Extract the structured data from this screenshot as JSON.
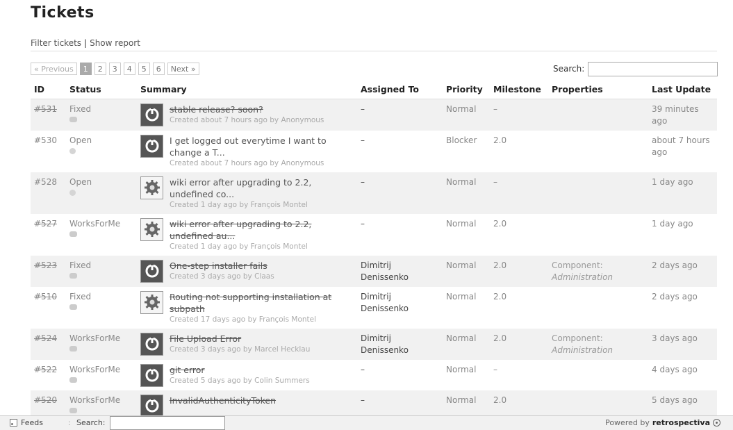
{
  "page_title": "Tickets",
  "subnav": {
    "filter": "Filter tickets",
    "separator": "|",
    "report": "Show report"
  },
  "pager": {
    "previous": "« Previous",
    "pages": [
      "1",
      "2",
      "3",
      "4",
      "5",
      "6"
    ],
    "current": "1",
    "next": "Next »"
  },
  "search": {
    "label": "Search:",
    "value": ""
  },
  "columns": {
    "id": "ID",
    "status": "Status",
    "summary": "Summary",
    "assigned": "Assigned To",
    "priority": "Priority",
    "milestone": "Milestone",
    "properties": "Properties",
    "updated": "Last Update"
  },
  "tickets": [
    {
      "id": "#531",
      "closed": true,
      "status": "Fixed",
      "avatar": "power-icon",
      "title": "stable release? soon?",
      "meta": "Created about 7 hours ago by Anonymous",
      "assigned": "–",
      "priority": "Normal",
      "milestone": "–",
      "prop_label": "",
      "prop_value": "",
      "updated": "39 minutes ago"
    },
    {
      "id": "#530",
      "closed": false,
      "status": "Open",
      "avatar": "power-icon",
      "title": "I get logged out everytime I want to change a T...",
      "meta": "Created about 7 hours ago by Anonymous",
      "assigned": "–",
      "priority": "Blocker",
      "milestone": "2.0",
      "prop_label": "",
      "prop_value": "",
      "updated": "about 7 hours ago"
    },
    {
      "id": "#528",
      "closed": false,
      "status": "Open",
      "avatar": "gear-icon",
      "title": "wiki error after upgrading to 2.2, undefined co...",
      "meta": "Created 1 day ago by François Montel",
      "assigned": "–",
      "priority": "Normal",
      "milestone": "–",
      "prop_label": "",
      "prop_value": "",
      "updated": "1 day ago"
    },
    {
      "id": "#527",
      "closed": true,
      "status": "WorksForMe",
      "avatar": "gear-icon",
      "title": "wiki error after upgrading to 2.2, undefined au...",
      "meta": "Created 1 day ago by François Montel",
      "assigned": "–",
      "priority": "Normal",
      "milestone": "2.0",
      "prop_label": "",
      "prop_value": "",
      "updated": "1 day ago"
    },
    {
      "id": "#523",
      "closed": true,
      "status": "Fixed",
      "avatar": "power-icon",
      "title": "One-step installer fails",
      "meta": "Created 3 days ago by Claas",
      "assigned": "Dimitrij Denissenko",
      "priority": "Normal",
      "milestone": "2.0",
      "prop_label": "Component:",
      "prop_value": "Administration",
      "updated": "2 days ago"
    },
    {
      "id": "#510",
      "closed": true,
      "status": "Fixed",
      "avatar": "gear-icon",
      "title": "Routing not supporting installation at subpath",
      "meta": "Created 17 days ago by François Montel",
      "assigned": "Dimitrij Denissenko",
      "priority": "Normal",
      "milestone": "2.0",
      "prop_label": "",
      "prop_value": "",
      "updated": "2 days ago"
    },
    {
      "id": "#524",
      "closed": true,
      "status": "WorksForMe",
      "avatar": "power-icon",
      "title": "File Upload Error",
      "meta": "Created 3 days ago by Marcel Hecklau",
      "assigned": "Dimitrij Denissenko",
      "priority": "Normal",
      "milestone": "2.0",
      "prop_label": "Component:",
      "prop_value": "Administration",
      "updated": "3 days ago"
    },
    {
      "id": "#522",
      "closed": true,
      "status": "WorksForMe",
      "avatar": "power-icon",
      "title": "git error",
      "meta": "Created 5 days ago by Colin Summers",
      "assigned": "–",
      "priority": "Normal",
      "milestone": "–",
      "prop_label": "",
      "prop_value": "",
      "updated": "4 days ago"
    },
    {
      "id": "#520",
      "closed": true,
      "status": "WorksForMe",
      "avatar": "power-icon",
      "title": "InvalidAuthenticityToken",
      "meta": "",
      "assigned": "–",
      "priority": "Normal",
      "milestone": "2.0",
      "prop_label": "",
      "prop_value": "",
      "updated": "5 days ago"
    }
  ],
  "footer": {
    "feeds": "Feeds",
    "search_label": "Search:",
    "search_value": "",
    "powered_by": "Powered by",
    "brand": "retrospectiva"
  }
}
